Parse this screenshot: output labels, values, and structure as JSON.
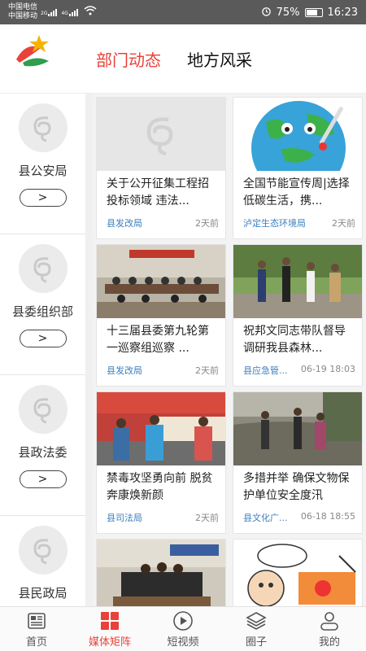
{
  "status_bar": {
    "carrier1": "中国电信",
    "carrier2": "中国移动",
    "net1": "2G",
    "net2": "4G",
    "battery_percent": "75%",
    "battery_level": 0.75,
    "time": "16:23"
  },
  "header": {
    "tabs": [
      {
        "label": "部门动态",
        "active": true
      },
      {
        "label": "地方风采",
        "active": false
      }
    ]
  },
  "departments": [
    {
      "name": "县公安局",
      "button": ">"
    },
    {
      "name": "县委组织部",
      "button": ">"
    },
    {
      "name": "县政法委",
      "button": ">"
    },
    {
      "name": "县民政局",
      "button": ">"
    }
  ],
  "news": [
    {
      "title": "关于公开征集工程招投标领域 违法...",
      "source": "县发改局",
      "time": "2天前",
      "image": "placeholder"
    },
    {
      "title": "全国节能宣传周|选择低碳生活，携...",
      "source": "泸定生态环境局",
      "time": "2天前",
      "image": "earth-cartoon"
    },
    {
      "title": "十三届县委第九轮第一巡察组巡察 ...",
      "source": "县发改局",
      "time": "2天前",
      "image": "meeting-room"
    },
    {
      "title": "祝邦文同志带队督导调研我县森林...",
      "source": "县应急管...",
      "time": "06-19 18:03",
      "image": "outdoor-group"
    },
    {
      "title": "禁毒攻坚勇向前 脱贫奔康焕新颜",
      "source": "县司法局",
      "time": "2天前",
      "image": "anti-drug-booth"
    },
    {
      "title": "多措并举 确保文物保护单位安全度汛",
      "source": "县文化广...",
      "time": "06-18 18:55",
      "image": "riverside-inspection"
    },
    {
      "title": "",
      "source": "",
      "time": "",
      "image": "office-interview"
    },
    {
      "title": "",
      "source": "",
      "time": "",
      "image": "anti-drug-cartoon"
    }
  ],
  "bottom_nav": [
    {
      "label": "首页",
      "icon": "news-icon",
      "active": false
    },
    {
      "label": "媒体矩阵",
      "icon": "grid-icon",
      "active": true
    },
    {
      "label": "短视频",
      "icon": "play-icon",
      "active": false
    },
    {
      "label": "圈子",
      "icon": "layers-icon",
      "active": false
    },
    {
      "label": "我的",
      "icon": "profile-icon",
      "active": false
    }
  ],
  "colors": {
    "accent": "#e8423a",
    "source_blue": "#3b7fbf",
    "status_bar": "#5a5a5a"
  }
}
